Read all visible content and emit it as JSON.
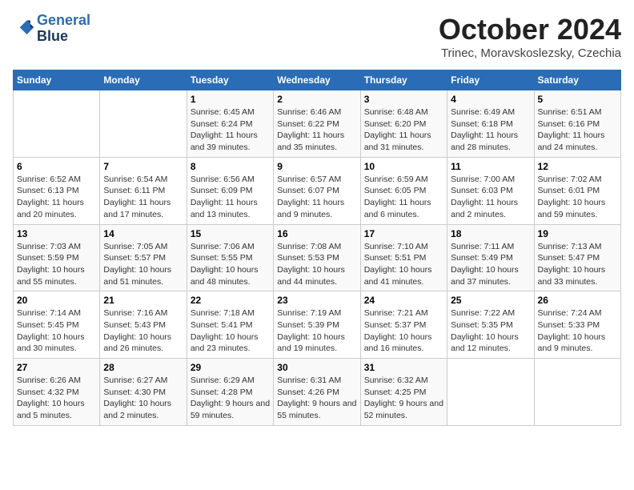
{
  "header": {
    "logo_line1": "General",
    "logo_line2": "Blue",
    "month": "October 2024",
    "location": "Trinec, Moravskoslezsky, Czechia"
  },
  "weekdays": [
    "Sunday",
    "Monday",
    "Tuesday",
    "Wednesday",
    "Thursday",
    "Friday",
    "Saturday"
  ],
  "weeks": [
    [
      {
        "day": "",
        "detail": ""
      },
      {
        "day": "",
        "detail": ""
      },
      {
        "day": "1",
        "detail": "Sunrise: 6:45 AM\nSunset: 6:24 PM\nDaylight: 11 hours and 39 minutes."
      },
      {
        "day": "2",
        "detail": "Sunrise: 6:46 AM\nSunset: 6:22 PM\nDaylight: 11 hours and 35 minutes."
      },
      {
        "day": "3",
        "detail": "Sunrise: 6:48 AM\nSunset: 6:20 PM\nDaylight: 11 hours and 31 minutes."
      },
      {
        "day": "4",
        "detail": "Sunrise: 6:49 AM\nSunset: 6:18 PM\nDaylight: 11 hours and 28 minutes."
      },
      {
        "day": "5",
        "detail": "Sunrise: 6:51 AM\nSunset: 6:16 PM\nDaylight: 11 hours and 24 minutes."
      }
    ],
    [
      {
        "day": "6",
        "detail": "Sunrise: 6:52 AM\nSunset: 6:13 PM\nDaylight: 11 hours and 20 minutes."
      },
      {
        "day": "7",
        "detail": "Sunrise: 6:54 AM\nSunset: 6:11 PM\nDaylight: 11 hours and 17 minutes."
      },
      {
        "day": "8",
        "detail": "Sunrise: 6:56 AM\nSunset: 6:09 PM\nDaylight: 11 hours and 13 minutes."
      },
      {
        "day": "9",
        "detail": "Sunrise: 6:57 AM\nSunset: 6:07 PM\nDaylight: 11 hours and 9 minutes."
      },
      {
        "day": "10",
        "detail": "Sunrise: 6:59 AM\nSunset: 6:05 PM\nDaylight: 11 hours and 6 minutes."
      },
      {
        "day": "11",
        "detail": "Sunrise: 7:00 AM\nSunset: 6:03 PM\nDaylight: 11 hours and 2 minutes."
      },
      {
        "day": "12",
        "detail": "Sunrise: 7:02 AM\nSunset: 6:01 PM\nDaylight: 10 hours and 59 minutes."
      }
    ],
    [
      {
        "day": "13",
        "detail": "Sunrise: 7:03 AM\nSunset: 5:59 PM\nDaylight: 10 hours and 55 minutes."
      },
      {
        "day": "14",
        "detail": "Sunrise: 7:05 AM\nSunset: 5:57 PM\nDaylight: 10 hours and 51 minutes."
      },
      {
        "day": "15",
        "detail": "Sunrise: 7:06 AM\nSunset: 5:55 PM\nDaylight: 10 hours and 48 minutes."
      },
      {
        "day": "16",
        "detail": "Sunrise: 7:08 AM\nSunset: 5:53 PM\nDaylight: 10 hours and 44 minutes."
      },
      {
        "day": "17",
        "detail": "Sunrise: 7:10 AM\nSunset: 5:51 PM\nDaylight: 10 hours and 41 minutes."
      },
      {
        "day": "18",
        "detail": "Sunrise: 7:11 AM\nSunset: 5:49 PM\nDaylight: 10 hours and 37 minutes."
      },
      {
        "day": "19",
        "detail": "Sunrise: 7:13 AM\nSunset: 5:47 PM\nDaylight: 10 hours and 33 minutes."
      }
    ],
    [
      {
        "day": "20",
        "detail": "Sunrise: 7:14 AM\nSunset: 5:45 PM\nDaylight: 10 hours and 30 minutes."
      },
      {
        "day": "21",
        "detail": "Sunrise: 7:16 AM\nSunset: 5:43 PM\nDaylight: 10 hours and 26 minutes."
      },
      {
        "day": "22",
        "detail": "Sunrise: 7:18 AM\nSunset: 5:41 PM\nDaylight: 10 hours and 23 minutes."
      },
      {
        "day": "23",
        "detail": "Sunrise: 7:19 AM\nSunset: 5:39 PM\nDaylight: 10 hours and 19 minutes."
      },
      {
        "day": "24",
        "detail": "Sunrise: 7:21 AM\nSunset: 5:37 PM\nDaylight: 10 hours and 16 minutes."
      },
      {
        "day": "25",
        "detail": "Sunrise: 7:22 AM\nSunset: 5:35 PM\nDaylight: 10 hours and 12 minutes."
      },
      {
        "day": "26",
        "detail": "Sunrise: 7:24 AM\nSunset: 5:33 PM\nDaylight: 10 hours and 9 minutes."
      }
    ],
    [
      {
        "day": "27",
        "detail": "Sunrise: 6:26 AM\nSunset: 4:32 PM\nDaylight: 10 hours and 5 minutes."
      },
      {
        "day": "28",
        "detail": "Sunrise: 6:27 AM\nSunset: 4:30 PM\nDaylight: 10 hours and 2 minutes."
      },
      {
        "day": "29",
        "detail": "Sunrise: 6:29 AM\nSunset: 4:28 PM\nDaylight: 9 hours and 59 minutes."
      },
      {
        "day": "30",
        "detail": "Sunrise: 6:31 AM\nSunset: 4:26 PM\nDaylight: 9 hours and 55 minutes."
      },
      {
        "day": "31",
        "detail": "Sunrise: 6:32 AM\nSunset: 4:25 PM\nDaylight: 9 hours and 52 minutes."
      },
      {
        "day": "",
        "detail": ""
      },
      {
        "day": "",
        "detail": ""
      }
    ]
  ]
}
